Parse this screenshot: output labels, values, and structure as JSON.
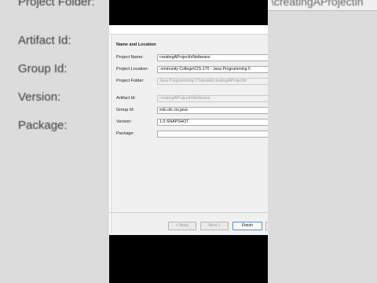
{
  "background": {
    "labels": [
      "Project Folder:",
      "Artifact Id:",
      "Group Id:",
      "Version:",
      "Package:"
    ],
    "right_text": "\\creatingAProjectin"
  },
  "dialog": {
    "section_title": "Name and Location",
    "fields": [
      {
        "label": "Project Name:",
        "value": "creatingAProjectInNetbeans",
        "disabled": false
      },
      {
        "label": "Project Location:",
        "value": ":ommunity College\\CIS-170 - Java Programming I\\",
        "disabled": false
      },
      {
        "label": "Project Folder:",
        "value": "Java Programming I\\Tutorials\\creatingAProjectIn",
        "disabled": true
      },
      {
        "label": "Artifact Id:",
        "value": "creatingAProjectInNetbeans",
        "disabled": true
      },
      {
        "label": "Group Id:",
        "value": "edu.otc.cis.java",
        "disabled": false
      },
      {
        "label": "Version:",
        "value": "1.0-SNAPSHOT",
        "disabled": false
      },
      {
        "label": "Package:",
        "value": "",
        "disabled": false
      }
    ],
    "buttons": {
      "back": "< Back",
      "next": "Next >",
      "finish": "Finish"
    }
  },
  "colors": {
    "dialog_bg": "#f0f0f0",
    "primary_border": "#5b8fd6"
  }
}
